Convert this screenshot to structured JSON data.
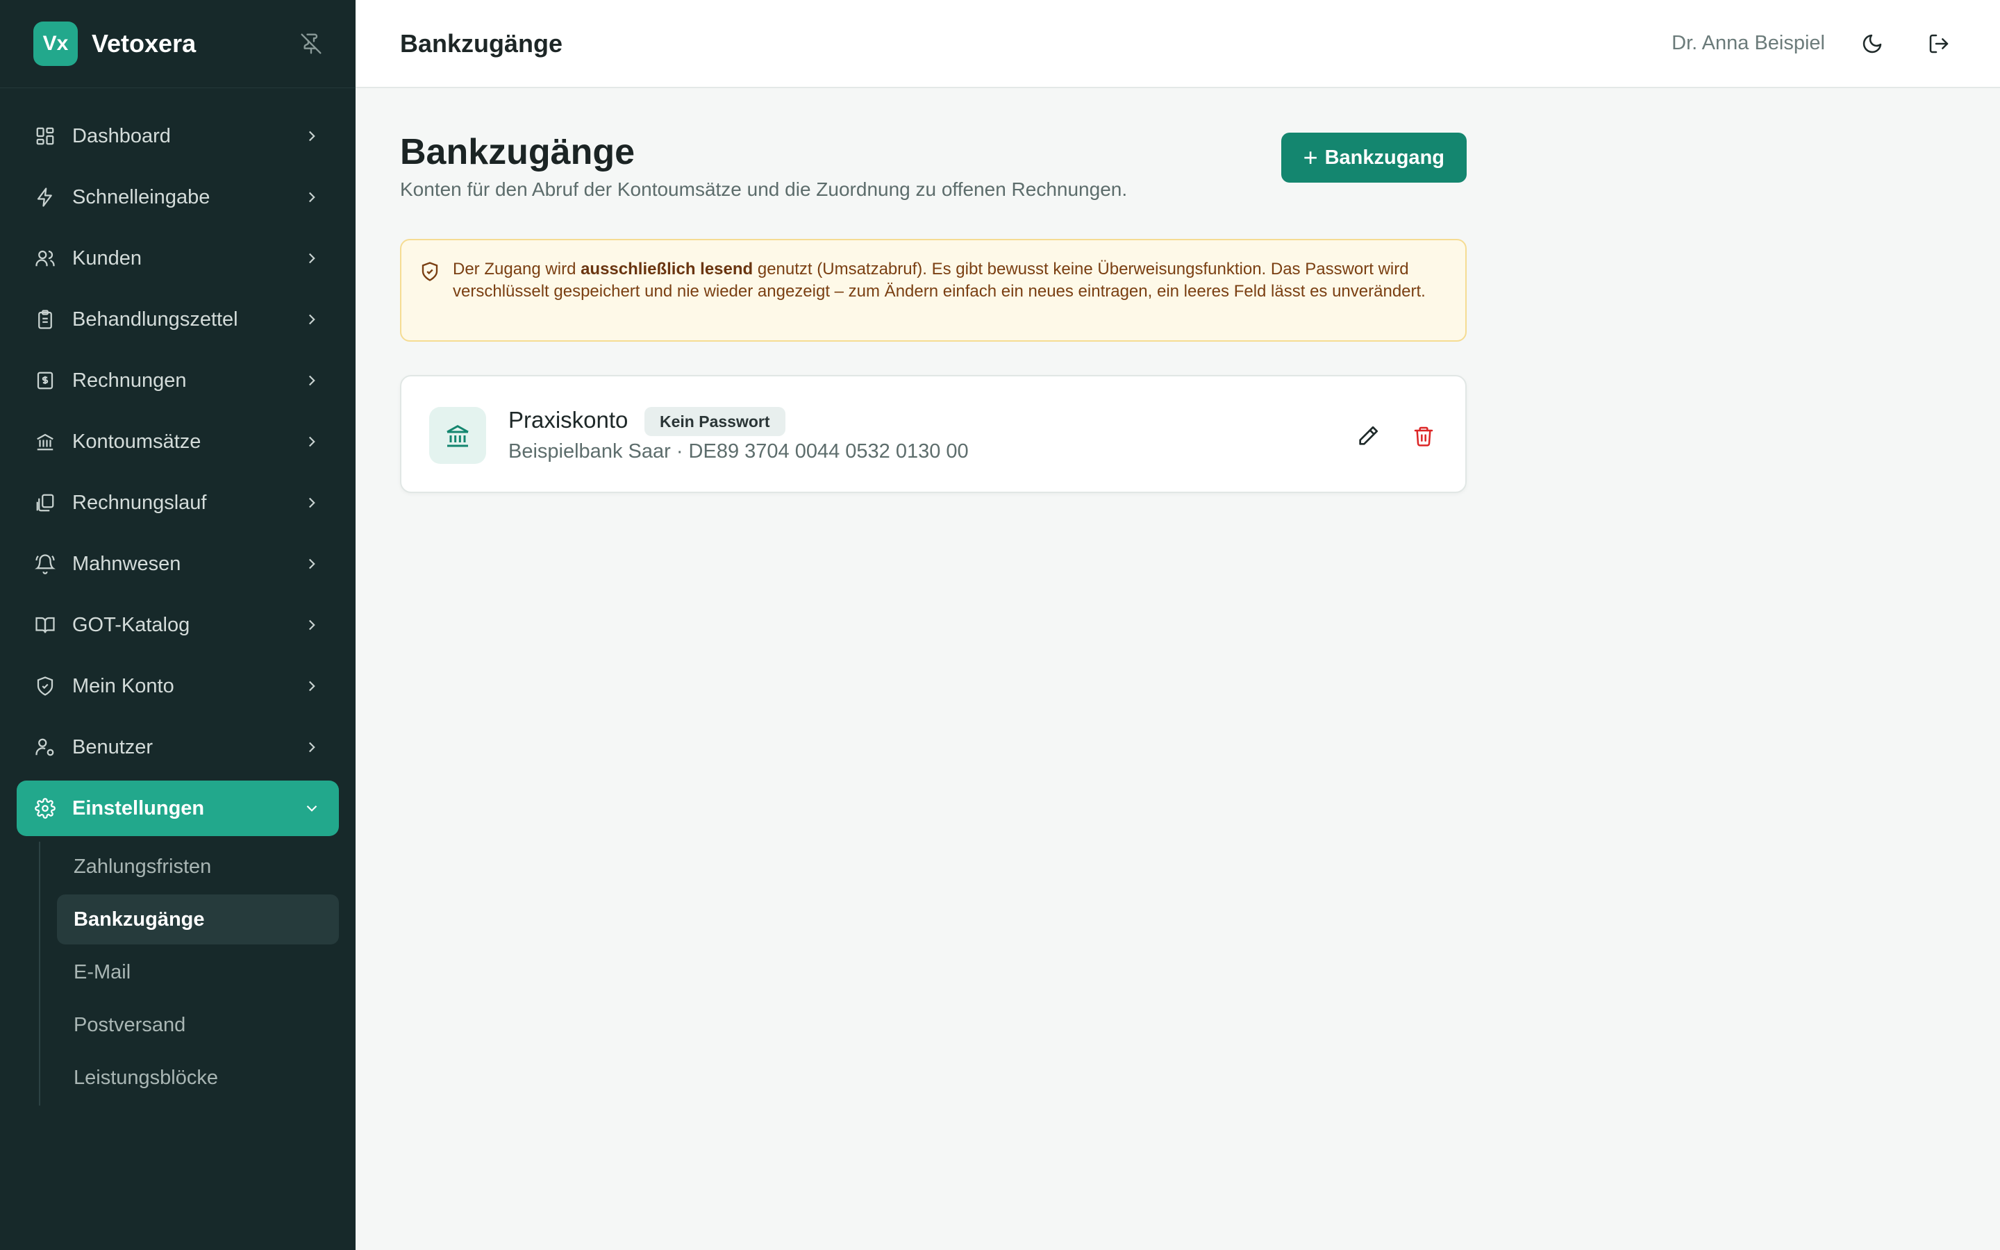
{
  "brand": {
    "logo": "Vx",
    "name": "Vetoxera"
  },
  "sidebar": {
    "items": [
      {
        "label": "Dashboard",
        "icon": "dashboard-icon"
      },
      {
        "label": "Schnelleingabe",
        "icon": "lightning-icon"
      },
      {
        "label": "Kunden",
        "icon": "users-icon"
      },
      {
        "label": "Behandlungszettel",
        "icon": "clipboard-icon"
      },
      {
        "label": "Rechnungen",
        "icon": "invoice-icon"
      },
      {
        "label": "Kontoumsätze",
        "icon": "bank-icon"
      },
      {
        "label": "Rechnungslauf",
        "icon": "copy-files-icon"
      },
      {
        "label": "Mahnwesen",
        "icon": "bell-icon"
      },
      {
        "label": "GOT-Katalog",
        "icon": "book-icon"
      },
      {
        "label": "Mein Konto",
        "icon": "shield-icon"
      },
      {
        "label": "Benutzer",
        "icon": "user-cog-icon"
      },
      {
        "label": "Einstellungen",
        "icon": "gear-icon",
        "active": true
      }
    ],
    "sub_items": [
      {
        "label": "Zahlungsfristen"
      },
      {
        "label": "Bankzugänge",
        "active": true
      },
      {
        "label": "E-Mail"
      },
      {
        "label": "Postversand"
      },
      {
        "label": "Leistungsblöcke"
      }
    ]
  },
  "header": {
    "title": "Bankzugänge",
    "user": "Dr. Anna Beispiel"
  },
  "page": {
    "title": "Bankzugänge",
    "subtitle": "Konten für den Abruf der Kontoumsätze und die Zuordnung zu offenen Rechnungen.",
    "add_button": "Bankzugang",
    "notice": {
      "prefix": "Der Zugang wird ",
      "bold": "ausschließlich lesend",
      "suffix": " genutzt (Umsatzabruf). Es gibt bewusst keine Überweisungsfunktion. Das Passwort wird verschlüsselt gespeichert und nie wieder angezeigt – zum Ändern einfach ein neues eintragen, ein leeres Feld lässt es unverändert."
    }
  },
  "accounts": [
    {
      "name": "Praxiskonto",
      "badge": "Kein Passwort",
      "detail": "Beispielbank Saar · DE89 3704 0044 0532 0130 00"
    }
  ],
  "colors": {
    "accent": "#22a88c",
    "primary_button": "#14866f",
    "sidebar_bg": "#17292a",
    "notice_bg": "#fef9e8",
    "danger": "#dc2626"
  }
}
